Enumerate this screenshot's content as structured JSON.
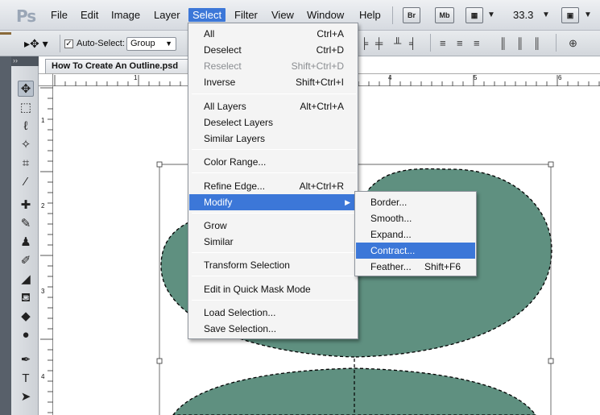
{
  "app": {
    "logo": "Ps"
  },
  "menubar": {
    "items": [
      "File",
      "Edit",
      "Image",
      "Layer",
      "Select",
      "Filter",
      "View",
      "Window",
      "Help"
    ],
    "active": "Select",
    "bridge_label": "Br",
    "minibridge_label": "Mb",
    "zoom": "33.3"
  },
  "options_bar": {
    "auto_select_label": "Auto-Select:",
    "auto_select_checked": true,
    "group_value": "Group"
  },
  "document": {
    "tab_title": "How To Create An Outline.psd",
    "hruler_labels": [
      "1",
      "4",
      "5",
      "6"
    ],
    "vruler_labels": [
      "1",
      "2",
      "3",
      "4"
    ],
    "shape_color": "#5f9080"
  },
  "select_menu": {
    "items": [
      {
        "label": "All",
        "shortcut": "Ctrl+A"
      },
      {
        "label": "Deselect",
        "shortcut": "Ctrl+D"
      },
      {
        "label": "Reselect",
        "shortcut": "Shift+Ctrl+D",
        "disabled": true
      },
      {
        "label": "Inverse",
        "shortcut": "Shift+Ctrl+I"
      },
      {
        "label": "All Layers",
        "shortcut": "Alt+Ctrl+A"
      },
      {
        "label": "Deselect Layers",
        "shortcut": ""
      },
      {
        "label": "Similar Layers",
        "shortcut": ""
      },
      {
        "label": "Color Range...",
        "shortcut": ""
      },
      {
        "label": "Refine Edge...",
        "shortcut": "Alt+Ctrl+R"
      },
      {
        "label": "Modify",
        "shortcut": "",
        "submenu": true,
        "highlighted": true
      },
      {
        "label": "Grow",
        "shortcut": ""
      },
      {
        "label": "Similar",
        "shortcut": ""
      },
      {
        "label": "Transform Selection",
        "shortcut": ""
      },
      {
        "label": "Edit in Quick Mask Mode",
        "shortcut": ""
      },
      {
        "label": "Load Selection...",
        "shortcut": ""
      },
      {
        "label": "Save Selection...",
        "shortcut": ""
      }
    ]
  },
  "modify_menu": {
    "items": [
      {
        "label": "Border...",
        "shortcut": ""
      },
      {
        "label": "Smooth...",
        "shortcut": ""
      },
      {
        "label": "Expand...",
        "shortcut": ""
      },
      {
        "label": "Contract...",
        "shortcut": "",
        "highlighted": true
      },
      {
        "label": "Feather...",
        "shortcut": "Shift+F6"
      }
    ]
  },
  "colors": {
    "accent": "#3c77d8",
    "shape": "#5f9080"
  }
}
